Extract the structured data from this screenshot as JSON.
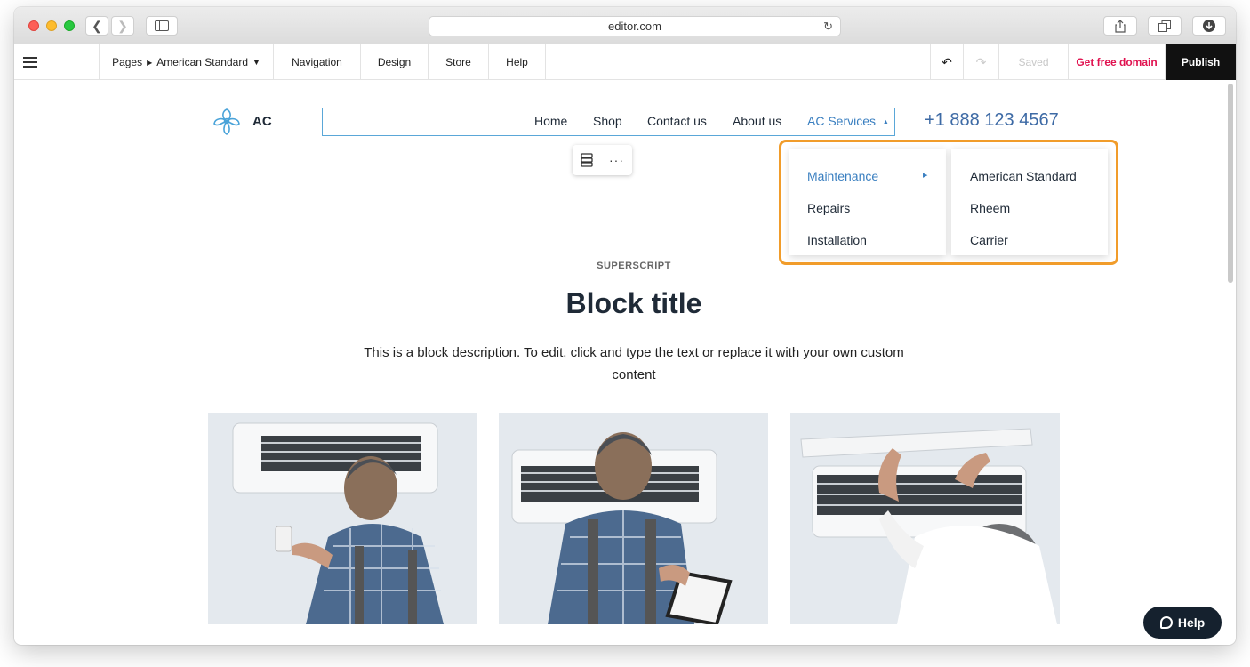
{
  "browser": {
    "url": "editor.com"
  },
  "toolbar": {
    "pages_label": "Pages",
    "current_page": "American Standard",
    "tabs": [
      "Navigation",
      "Design",
      "Store",
      "Help"
    ],
    "saved_label": "Saved",
    "free_domain_label": "Get free domain",
    "publish_label": "Publish"
  },
  "site": {
    "brand": "AC",
    "nav": [
      {
        "label": "Home"
      },
      {
        "label": "Shop"
      },
      {
        "label": "Contact us"
      },
      {
        "label": "About us"
      },
      {
        "label": "AC Services"
      }
    ],
    "phone": "+1 888 123 4567"
  },
  "dropdown": {
    "level1": [
      {
        "label": "Maintenance"
      },
      {
        "label": "Repairs"
      },
      {
        "label": "Installation"
      }
    ],
    "level2": [
      {
        "label": "American Standard"
      },
      {
        "label": "Rheem"
      },
      {
        "label": "Carrier"
      }
    ]
  },
  "block": {
    "superscript": "SUPERSCRIPT",
    "title": "Block title",
    "description": "This is a block description. To edit, click and type the text or replace it with your own custom content"
  },
  "help_label": "Help",
  "colors": {
    "accent": "#3a7fc0",
    "highlight": "#f19c2a",
    "publish_bg": "#111111",
    "free_domain": "#e0114f"
  }
}
